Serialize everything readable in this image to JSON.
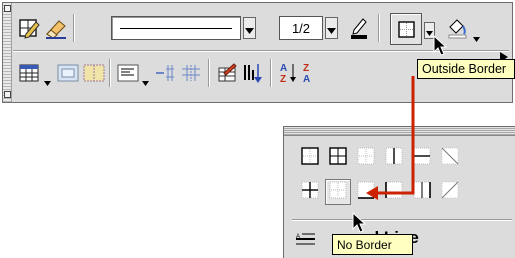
{
  "toolbar": {
    "line_weight": "1/2",
    "tooltip_outside": "Outside Border"
  },
  "palette": {
    "tooltip_no_border": "No Border",
    "diagonal_label_fragment": "al Line"
  },
  "colors": {
    "tooltip_bg": "#ffffc0",
    "arrow": "#cc2200",
    "toolbar_bg": "#dcdcdc"
  },
  "icons": [
    "draw-table-icon",
    "eraser-icon",
    "border-color-icon",
    "borders-icon",
    "shading-icon",
    "insert-table-icon",
    "merge-cells-icon",
    "split-cells-icon",
    "align-icon",
    "distribute-rows-icon",
    "distribute-columns-icon",
    "table-autoformat-icon",
    "sort-icon",
    "sort-ascending-icon",
    "sort-descending-icon",
    "outside-border-icon",
    "all-borders-icon",
    "inside-border-icon",
    "no-border-icon"
  ]
}
